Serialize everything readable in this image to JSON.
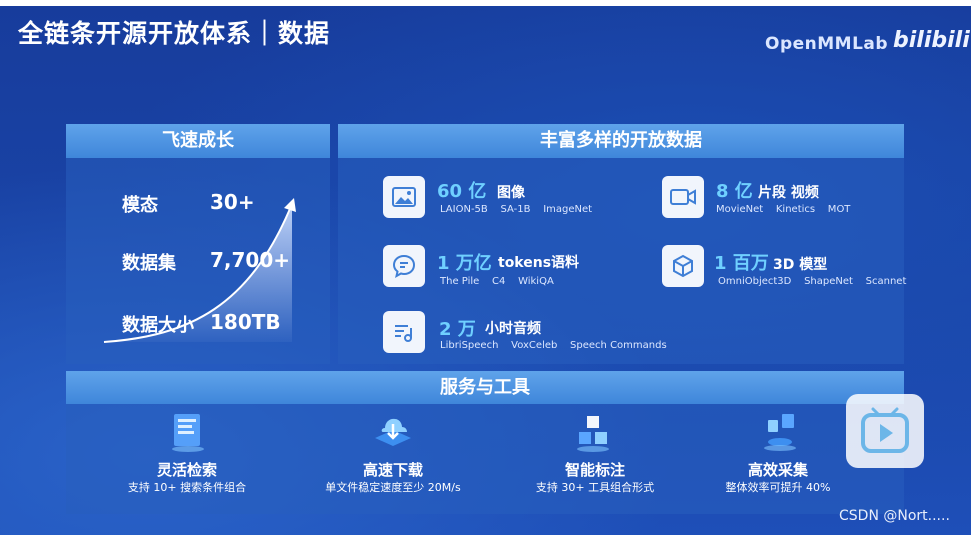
{
  "title": "全链条开源开放体系｜数据",
  "brand": {
    "name": "OpenMMLab",
    "logo": "bilibili"
  },
  "growth": {
    "header": "飞速成长",
    "stats": [
      {
        "label": "模态",
        "value": "30+"
      },
      {
        "label": "数据集",
        "value": "7,700+"
      },
      {
        "label": "数据大小",
        "value": "180TB"
      }
    ]
  },
  "open_data": {
    "header": "丰富多样的开放数据",
    "items": [
      {
        "icon": "image-icon",
        "big": "60 亿",
        "kind": "图像",
        "subs": "LAION-5B    SA-1B    ImageNet"
      },
      {
        "icon": "video-icon",
        "big": "8 亿",
        "kind": "片段 视频",
        "subs": "MovieNet    Kinetics    MOT"
      },
      {
        "icon": "chat-bubble-icon",
        "big": "1 万亿",
        "kind": "tokens语料",
        "subs": "The Pile    C4    WikiQA"
      },
      {
        "icon": "cube-icon",
        "big": "1 百万",
        "kind": "3D 模型",
        "subs": "OmniObject3D    ShapeNet    Scannet"
      },
      {
        "icon": "audio-icon",
        "big": "2 万",
        "kind": "小时音频",
        "subs": "LibriSpeech    VoxCeleb    Speech Commands"
      }
    ]
  },
  "services": {
    "header": "服务与工具",
    "tools": [
      {
        "icon": "search-panel-icon",
        "name": "灵活检索",
        "desc": "支持 10+ 搜索条件组合"
      },
      {
        "icon": "download-cloud-icon",
        "name": "高速下载",
        "desc": "单文件稳定速度至少 20M/s"
      },
      {
        "icon": "cubes-icon",
        "name": "智能标注",
        "desc": "支持 30+ 工具组合形式"
      },
      {
        "icon": "collect-icon",
        "name": "高效采集",
        "desc": "整体效率可提升 40%"
      }
    ]
  },
  "watermark": "CSDN @Nort.....",
  "colors": {
    "accent": "#6fd0ff",
    "header": "#4a90e2",
    "background": "#1a45a8"
  }
}
